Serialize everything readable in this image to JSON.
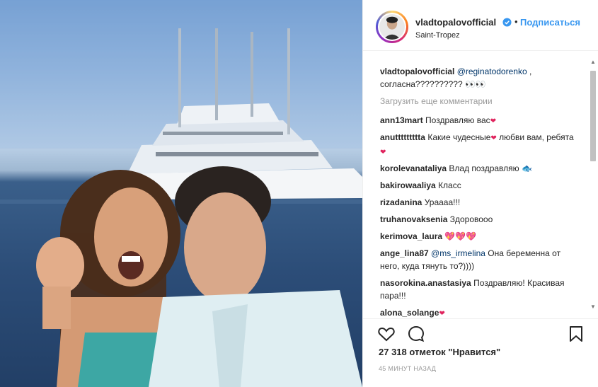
{
  "post": {
    "username": "vladtopalovofficial",
    "follow_label": "Подписаться",
    "dot": "•",
    "location": "Saint-Tropez",
    "icons": {
      "verified": "verified-badge-icon",
      "like": "heart-icon",
      "comment": "comment-icon",
      "save": "bookmark-icon"
    },
    "colors": {
      "accent": "#3897f0",
      "text": "#262626",
      "muted": "#999999",
      "heart": "#e0245e"
    }
  },
  "caption": {
    "username": "vladtopalovofficial",
    "mention": "@reginatodorenko",
    "text_line1_suffix": " ,",
    "text_line2": "согласна?????????? 👀👀"
  },
  "load_more": "Загрузить еще комментарии",
  "comments": [
    {
      "user": "ann13mart",
      "text": "Поздравляю вас",
      "emoji": "❤"
    },
    {
      "user": "anuttttttttta",
      "text": "Какие чудесные",
      "emoji": "❤",
      "text2": " любви вам, ребята",
      "emoji2": "❤"
    },
    {
      "user": "korolevanataliya",
      "text": "Влад поздравляю",
      "emoji": "🐟"
    },
    {
      "user": "bakirowaaliya",
      "text": "Класс"
    },
    {
      "user": "rizadanina",
      "text": "Ураааа!!!"
    },
    {
      "user": "truhanovaksenia",
      "text": "Здоровооо"
    },
    {
      "user": "kerimova_laura",
      "text": "",
      "emoji": "💖💖💖"
    },
    {
      "user": "ange_lina87",
      "mention": "@ms_irmelina",
      "text": " Она беременна от него, куда тянуть то?))))"
    },
    {
      "user": "nasorokina.anastasiya",
      "text": "Поздравляю! Красивая пара!!!"
    },
    {
      "user": "alona_solange",
      "emoji": "❤"
    }
  ],
  "footer": {
    "likes": "27 318 отметок \"Нравится\"",
    "time": "45 МИНУТ НАЗАД"
  }
}
